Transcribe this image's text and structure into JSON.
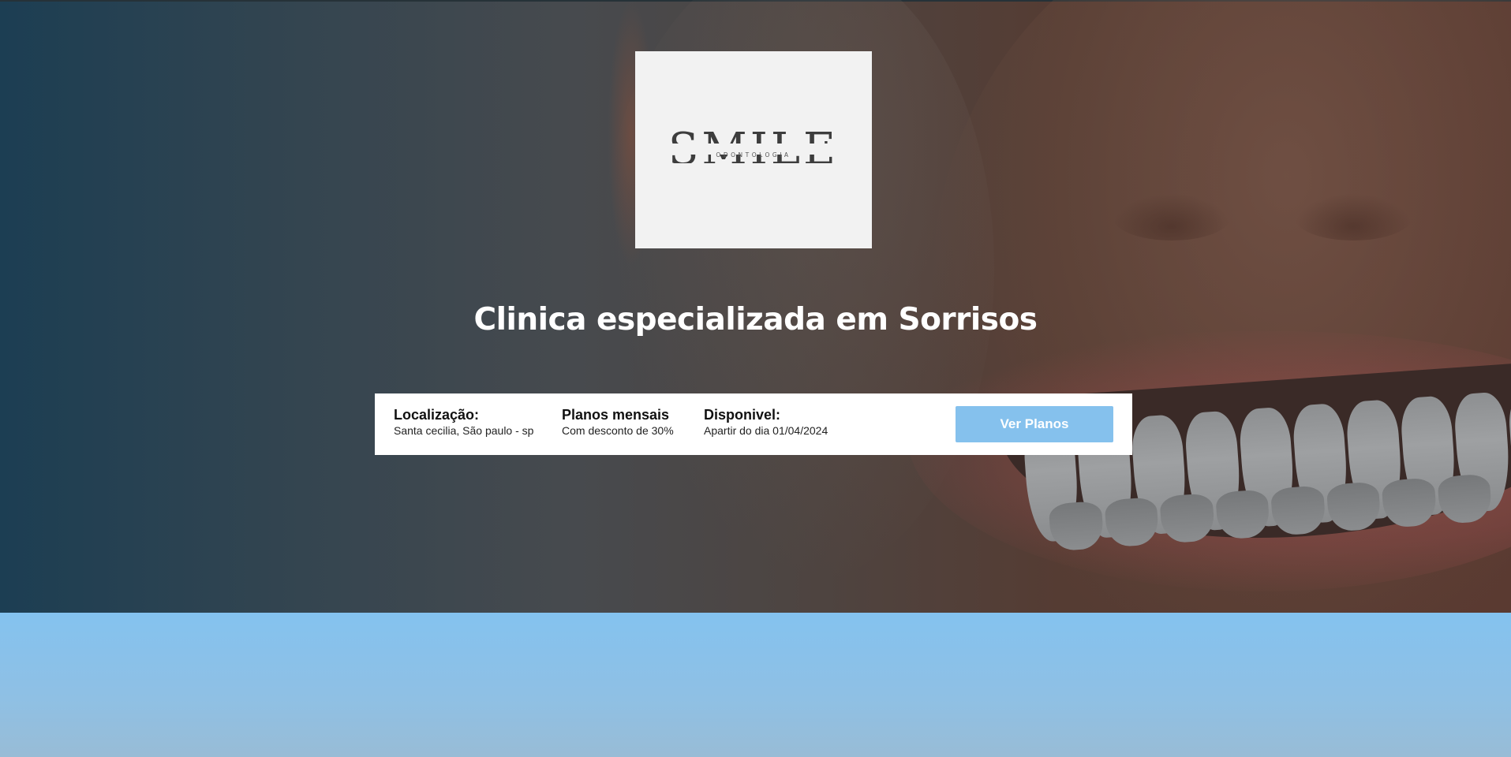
{
  "logo": {
    "wordmark": "SMILE",
    "tagline": "ODONTOLOGIA"
  },
  "hero": {
    "headline": "Clinica especializada em Sorrisos",
    "background_image": "smiling-mouth-photo"
  },
  "infobar": {
    "items": [
      {
        "title": "Localização:",
        "subtitle": "Santa cecilia, São paulo - sp"
      },
      {
        "title": "Planos mensais",
        "subtitle": "Com desconto de 30%"
      },
      {
        "title": "Disponivel:",
        "subtitle": "Apartir do dia 01/04/2024"
      }
    ],
    "button_label": "Ver Planos"
  },
  "colors": {
    "accent": "#85c1ed",
    "hero_left": "#1c3e53",
    "hero_right": "#5a3a31",
    "logo_bg": "#f2f2f2",
    "headline_text": "#ffffff"
  }
}
